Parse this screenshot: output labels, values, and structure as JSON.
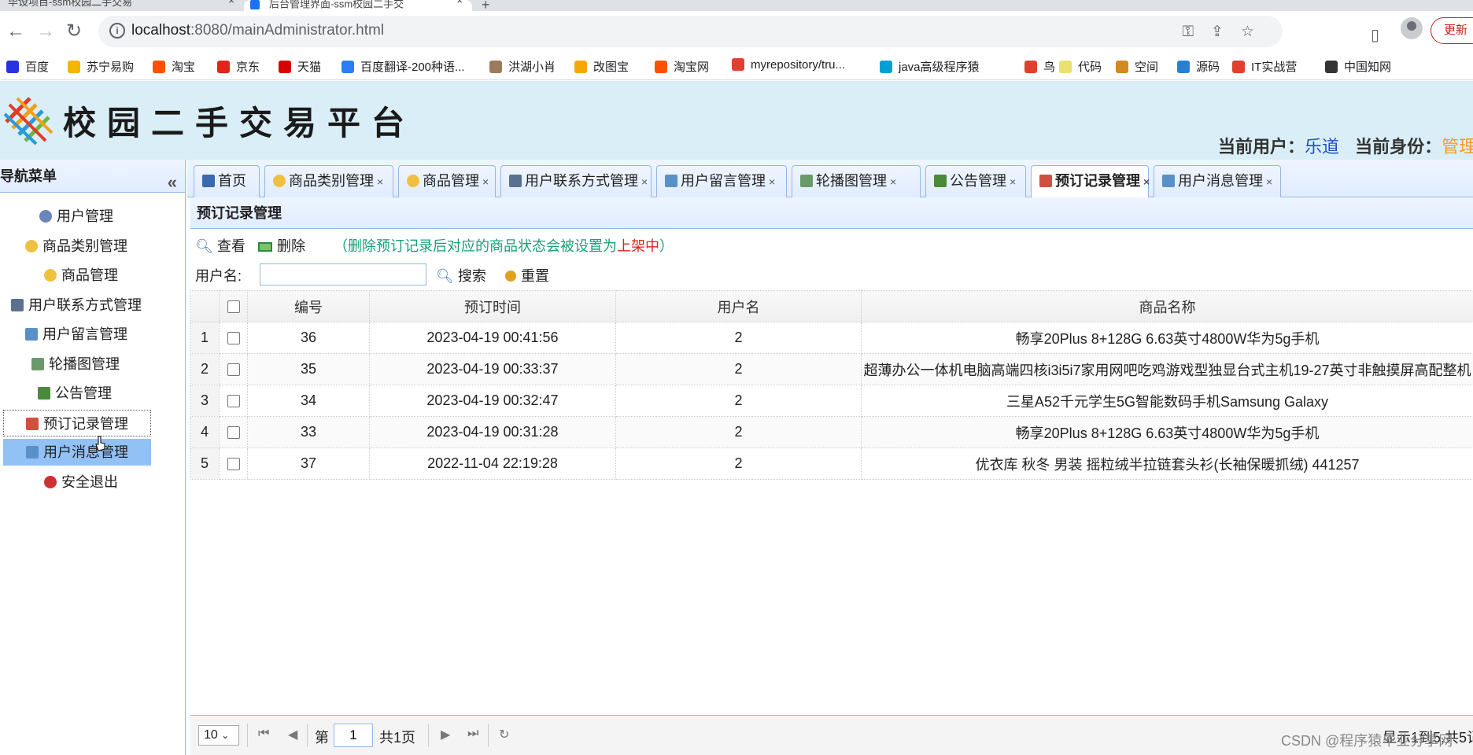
{
  "browser": {
    "tab1_title": "毕设项目-ssm校园二手交易",
    "tab2_title": "后台管理界面-ssm校园二手交",
    "url_host": "localhost",
    "url_path": ":8080/mainAdministrator.html",
    "update_label": "更新"
  },
  "bookmarks": [
    {
      "label": "百度",
      "color": "#2932e1"
    },
    {
      "label": "苏宁易购",
      "color": "#f5b400"
    },
    {
      "label": "淘宝",
      "color": "#ff5000"
    },
    {
      "label": "京东",
      "color": "#e1251b"
    },
    {
      "label": "天猫",
      "color": "#d80000"
    },
    {
      "label": "百度翻译-200种语...",
      "color": "#2a7df4"
    },
    {
      "label": "洪湖小肖",
      "color": "#9b7b5a"
    },
    {
      "label": "改图宝",
      "color": "#f6a800"
    },
    {
      "label": "淘宝网",
      "color": "#ff5000"
    },
    {
      "label": "myrepository/tru...",
      "color": "#e04030"
    },
    {
      "label": "java高级程序猿",
      "color": "#00a1d6"
    },
    {
      "label": "鸟",
      "color": "#e04030"
    },
    {
      "label": "代码",
      "color": "#e8e070"
    },
    {
      "label": "空间",
      "color": "#d08a20"
    },
    {
      "label": "源码",
      "color": "#2a80d0"
    },
    {
      "label": "IT实战营",
      "color": "#e04030"
    },
    {
      "label": "中国知网",
      "color": "#333333"
    }
  ],
  "header": {
    "site_title": "校园二手交易平台",
    "current_user_label": "当前用户：",
    "current_user": "乐道",
    "current_role_label": "当前身份：",
    "current_role": "管理"
  },
  "sidebar": {
    "title": "导航菜单",
    "items": [
      {
        "label": "用户管理",
        "icon": "user-icon",
        "color": "#6a85b8"
      },
      {
        "label": "商品类别管理",
        "icon": "gear-icon",
        "color": "#f0c040"
      },
      {
        "label": "商品管理",
        "icon": "star-icon",
        "color": "#f0c040"
      },
      {
        "label": "用户联系方式管理",
        "icon": "phone-icon",
        "color": "#5a7090"
      },
      {
        "label": "用户留言管理",
        "icon": "comments-icon",
        "color": "#5a90c8"
      },
      {
        "label": "轮播图管理",
        "icon": "images-icon",
        "color": "#6a9a6a"
      },
      {
        "label": "公告管理",
        "icon": "board-icon",
        "color": "#4a8a3a"
      },
      {
        "label": "预订记录管理",
        "icon": "calendar-icon",
        "color": "#d05040"
      },
      {
        "label": "用户消息管理",
        "icon": "message-icon",
        "color": "#5a90c8"
      },
      {
        "label": "安全退出",
        "icon": "power-icon",
        "color": "#d03030"
      }
    ]
  },
  "tabs": [
    {
      "label": "首页",
      "icon": "home-icon",
      "color": "#3a6ab0",
      "closable": false
    },
    {
      "label": "商品类别管理",
      "icon": "gear-icon",
      "color": "#f0c040",
      "closable": true
    },
    {
      "label": "商品管理",
      "icon": "star-icon",
      "color": "#f0c040",
      "closable": true
    },
    {
      "label": "用户联系方式管理",
      "icon": "phone-icon",
      "color": "#5a7090",
      "closable": true
    },
    {
      "label": "用户留言管理",
      "icon": "comments-icon",
      "color": "#5a90c8",
      "closable": true
    },
    {
      "label": "轮播图管理",
      "icon": "images-icon",
      "color": "#6a9a6a",
      "closable": true
    },
    {
      "label": "公告管理",
      "icon": "board-icon",
      "color": "#4a8a3a",
      "closable": true
    },
    {
      "label": "预订记录管理",
      "icon": "calendar-icon",
      "color": "#d05040",
      "closable": true
    },
    {
      "label": "用户消息管理",
      "icon": "message-icon",
      "color": "#5a90c8",
      "closable": true
    }
  ],
  "tab_close": "×",
  "panel": {
    "title": "预订记录管理",
    "view_label": "查看",
    "delete_label": "删除",
    "note_prefix": "（删除预订记录后对应的商品状态会被设置为",
    "note_highlight": "上架中",
    "note_suffix": "）",
    "username_label": "用户名:",
    "username_value": "",
    "search_label": "搜索",
    "reset_label": "重置"
  },
  "grid": {
    "columns": [
      "编号",
      "预订时间",
      "用户名",
      "商品名称"
    ],
    "rows": [
      {
        "n": "1",
        "id": "36",
        "time": "2023-04-19 00:41:56",
        "user": "2",
        "goods": "畅享20Plus 8+128G 6.63英寸4800W华为5g手机"
      },
      {
        "n": "2",
        "id": "35",
        "time": "2023-04-19 00:33:37",
        "user": "2",
        "goods": "超薄办公一体机电脑高端四核i3i5i7家用网吧吃鸡游戏型独显台式主机19-27英寸非触摸屏高配整机"
      },
      {
        "n": "3",
        "id": "34",
        "time": "2023-04-19 00:32:47",
        "user": "2",
        "goods": "三星A52千元学生5G智能数码手机Samsung Galaxy"
      },
      {
        "n": "4",
        "id": "33",
        "time": "2023-04-19 00:31:28",
        "user": "2",
        "goods": "畅享20Plus 8+128G 6.63英寸4800W华为5g手机"
      },
      {
        "n": "5",
        "id": "37",
        "time": "2022-11-04 22:19:28",
        "user": "2",
        "goods": "优衣库 秋冬 男装 摇粒绒半拉链套头衫(长袖保暖抓绒) 441257"
      }
    ]
  },
  "pager": {
    "page_size": "10",
    "page_prefix": "第",
    "page_value": "1",
    "page_suffix": "共1页",
    "display_text": "显示1到5,共5记"
  },
  "watermark": "CSDN @程序猿毕业分享网"
}
